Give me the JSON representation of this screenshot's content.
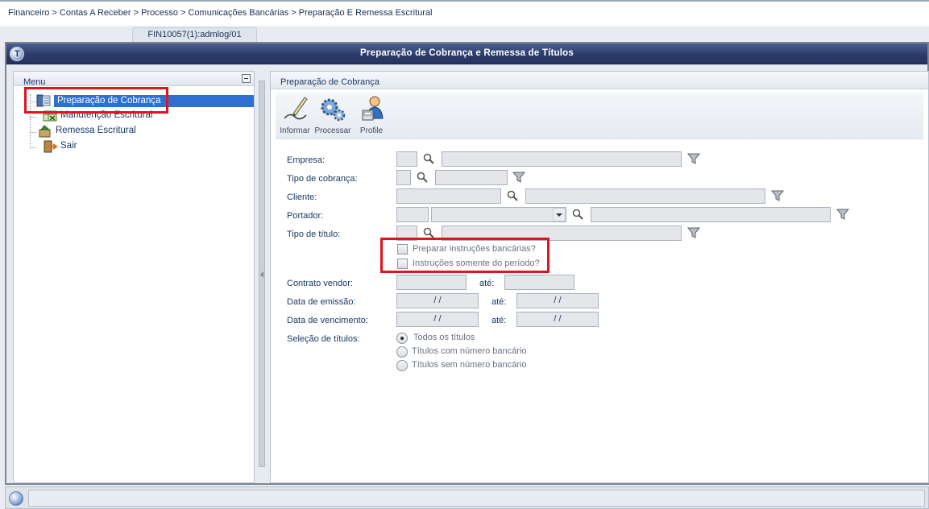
{
  "breadcrumb": "Financeiro > Contas A Receber > Processo > Comunicações Bancárias > Preparação E Remessa Escritural",
  "tab": {
    "label": "FIN10057(1):admlog/01"
  },
  "window": {
    "title": "Preparação de Cobrança e Remessa de Títulos"
  },
  "menu": {
    "header": "Menu",
    "items": [
      {
        "label": "Preparação de Cobrança",
        "selected": true,
        "icon": "register-icon"
      },
      {
        "label": "Manutenção Escritural",
        "icon": "spreadsheet-icon"
      },
      {
        "label": "Remessa Escritural",
        "icon": "send-icon"
      },
      {
        "label": "Sair",
        "icon": "exit-icon"
      }
    ]
  },
  "main": {
    "header": "Preparação de Cobrança",
    "toolbar": [
      {
        "label": "Informar",
        "icon": "pen-icon"
      },
      {
        "label": "Processar",
        "icon": "gears-icon"
      },
      {
        "label": "Profile",
        "icon": "user-profile-icon"
      }
    ],
    "form": {
      "empresa_label": "Empresa:",
      "tipo_cobranca_label": "Tipo de cobrança:",
      "cliente_label": "Cliente:",
      "portador_label": "Portador:",
      "tipo_titulo_label": "Tipo de título:",
      "preparar_label": "Preparar instruções bancárias?",
      "instrucoes_label": "Instruções somente do período?",
      "contrato_label": "Contrato vendor:",
      "ate_label": "até:",
      "emissao_label": "Data de emissão:",
      "vencimento_label": "Data de vencimento:",
      "date_empty": "/ /",
      "selecao_label": "Seleção de títulos:",
      "selecao_options": [
        "Todos os títulos",
        "Títulos com número bancário",
        "Títulos sem número bancário"
      ],
      "selecao_selected": "Todos os títulos"
    }
  },
  "colors": {
    "titlebar": "#2c3b6a",
    "selection": "#2e6fd1",
    "highlight": "#e0141e"
  }
}
